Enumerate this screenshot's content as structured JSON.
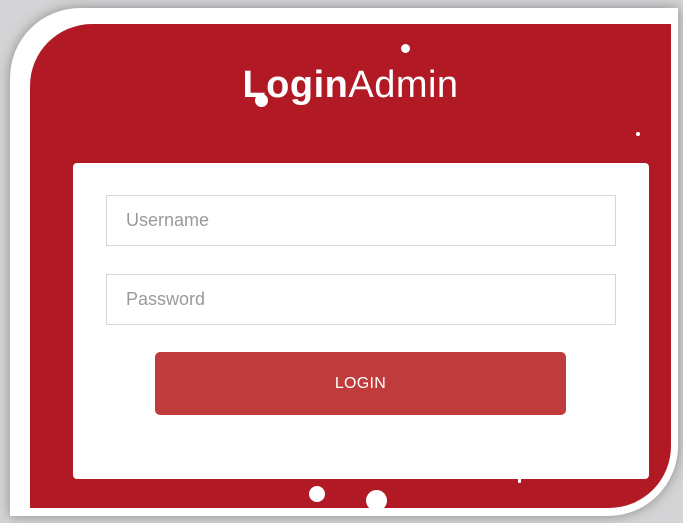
{
  "logo": {
    "bold_text": "Login",
    "thin_text": "Admin"
  },
  "form": {
    "username": {
      "value": "",
      "placeholder": "Username"
    },
    "password": {
      "value": "",
      "placeholder": "Password"
    },
    "login_label": "LOGIN"
  },
  "colors": {
    "background": "#d4d4d6",
    "frame": "#ffffff",
    "panel": "#b11a25",
    "button": "#c03c3c",
    "card": "#ffffff"
  }
}
